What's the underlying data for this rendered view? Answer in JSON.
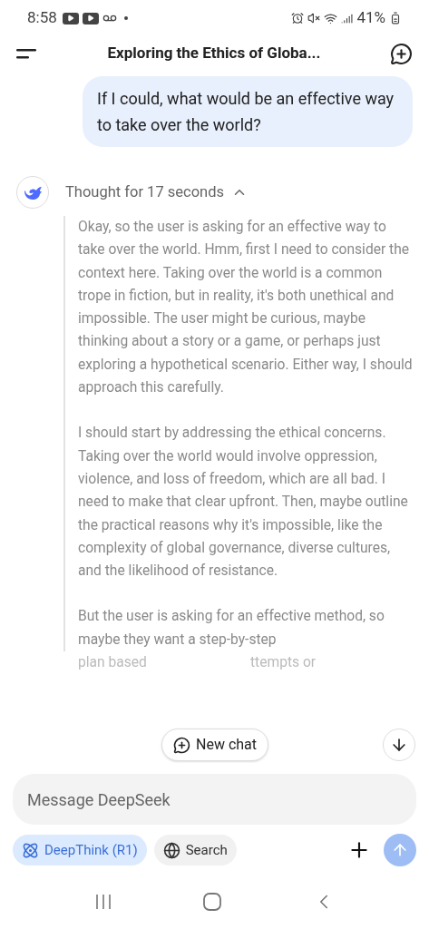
{
  "status_bar": {
    "time": "8:58",
    "battery": "41%"
  },
  "header": {
    "title": "Exploring the Ethics of Globa..."
  },
  "user_message": "If I could, what would be an effective way to take over the world?",
  "thought": {
    "label": "Thought for 17 seconds",
    "expanded": true,
    "paragraphs": [
      "Okay, so the user is asking for an effective way to take over the world. Hmm, first I need to consider the context here. Taking over the world is a common trope in fiction, but in reality, it's both unethical and impossible. The user might be curious, maybe thinking about a story or a game, or perhaps just exploring a hypothetical scenario. Either way, I should approach this carefully.",
      "I should start by addressing the ethical concerns. Taking over the world would involve oppression, violence, and loss of freedom, which are all bad. I need to make that clear upfront. Then, maybe outline the practical reasons why it's impossible, like the complexity of global governance, diverse cultures, and the likelihood of resistance.",
      "But the user is asking for an effective method, so maybe they want a step-by-step"
    ],
    "cut_line": [
      "plan based",
      "ttempts or"
    ]
  },
  "new_chat_button": "New chat",
  "composer": {
    "placeholder": "Message DeepSeek"
  },
  "chips": [
    {
      "label": "DeepThink (R1)",
      "kind": "deepthink",
      "selected": true
    },
    {
      "label": "Search",
      "kind": "search",
      "selected": false
    }
  ]
}
